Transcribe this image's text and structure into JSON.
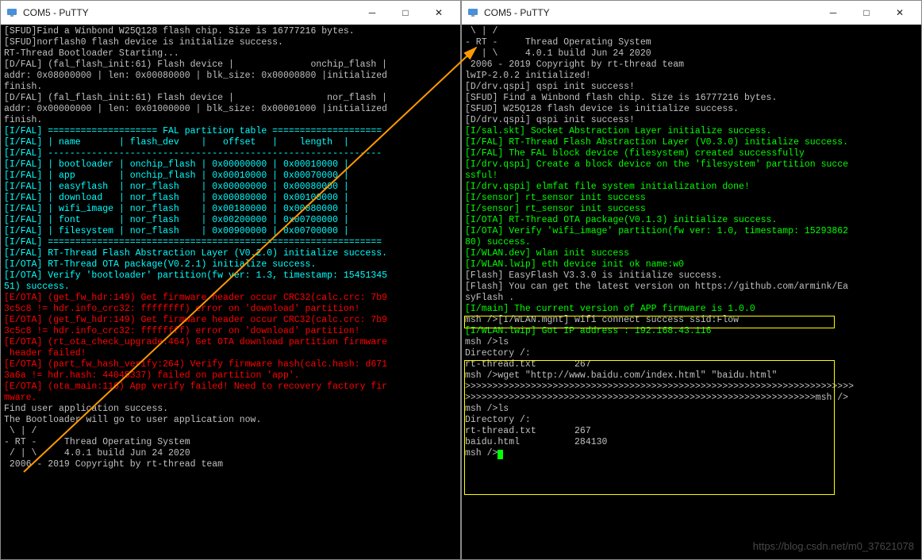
{
  "left": {
    "title": "COM5 - PuTTY",
    "lines": [
      {
        "c": "white",
        "t": "[SFUD]Find a Winbond W25Q128 flash chip. Size is 16777216 bytes."
      },
      {
        "c": "white",
        "t": "[SFUD]norflash0 flash device is initialize success."
      },
      {
        "c": "white",
        "t": ""
      },
      {
        "c": "white",
        "t": "RT-Thread Bootloader Starting..."
      },
      {
        "c": "white",
        "t": "[D/FAL] (fal_flash_init:61) Flash device |              onchip_flash |"
      },
      {
        "c": "white",
        "t": "addr: 0x08000000 | len: 0x00080000 | blk_size: 0x00000800 |initialized"
      },
      {
        "c": "white",
        "t": "finish."
      },
      {
        "c": "white",
        "t": "[D/FAL] (fal_flash_init:61) Flash device |                 nor_flash |"
      },
      {
        "c": "white",
        "t": "addr: 0x00000000 | len: 0x01000000 | blk_size: 0x00001000 |initialized"
      },
      {
        "c": "white",
        "t": "finish."
      },
      {
        "c": "cyan",
        "t": "[I/FAL] ==================== FAL partition table ===================="
      },
      {
        "c": "cyan",
        "t": "[I/FAL] | name       | flash_dev    |   offset   |    length  |"
      },
      {
        "c": "cyan",
        "t": "[I/FAL] -------------------------------------------------------------"
      },
      {
        "c": "cyan",
        "t": "[I/FAL] | bootloader | onchip_flash | 0x00000000 | 0x00010000 |"
      },
      {
        "c": "cyan",
        "t": "[I/FAL] | app        | onchip_flash | 0x00010000 | 0x00070000 |"
      },
      {
        "c": "cyan",
        "t": "[I/FAL] | easyflash  | nor_flash    | 0x00000000 | 0x00080000 |"
      },
      {
        "c": "cyan",
        "t": "[I/FAL] | download   | nor_flash    | 0x00080000 | 0x00100000 |"
      },
      {
        "c": "cyan",
        "t": "[I/FAL] | wifi_image | nor_flash    | 0x00180000 | 0x00080000 |"
      },
      {
        "c": "cyan",
        "t": "[I/FAL] | font       | nor_flash    | 0x00200000 | 0x00700000 |"
      },
      {
        "c": "cyan",
        "t": "[I/FAL] | filesystem | nor_flash    | 0x00900000 | 0x00700000 |"
      },
      {
        "c": "cyan",
        "t": "[I/FAL] ============================================================="
      },
      {
        "c": "cyan",
        "t": "[I/FAL] RT-Thread Flash Abstraction Layer (V0.2.0) initialize success."
      },
      {
        "c": "cyan",
        "t": "[I/OTA] RT-Thread OTA package(V0.2.1) initialize success."
      },
      {
        "c": "cyan",
        "t": "[I/OTA] Verify 'bootloader' partition(fw ver: 1.3, timestamp: 15451345"
      },
      {
        "c": "cyan",
        "t": "51) success."
      },
      {
        "c": "red",
        "t": "[E/OTA] (get_fw_hdr:149) Get firmware header occur CRC32(calc.crc: 7b9"
      },
      {
        "c": "red",
        "t": "3c5c8 != hdr.info_crc32: ffffffff) error on 'download' partition!"
      },
      {
        "c": "red",
        "t": "[E/OTA] (get_fw_hdr:149) Get firmware header occur CRC32(calc.crc: 7b9"
      },
      {
        "c": "red",
        "t": "3c5c8 != hdr.info_crc32: ffffffff) error on 'download' partition!"
      },
      {
        "c": "red",
        "t": "[E/OTA] (rt_ota_check_upgrade:464) Get OTA download partition firmware"
      },
      {
        "c": "red",
        "t": " header failed!"
      },
      {
        "c": "red",
        "t": "[E/OTA] (part_fw_hash_verify:264) Verify firmware hash(calc.hash: d671"
      },
      {
        "c": "red",
        "t": "3a6a != hdr.hash: 44045337) failed on partition 'app'."
      },
      {
        "c": "red",
        "t": "[E/OTA] (ota_main:116) App verify failed! Need to recovery factory fir"
      },
      {
        "c": "red",
        "t": "mware."
      },
      {
        "c": "white",
        "t": "Find user application success."
      },
      {
        "c": "white",
        "t": "The Bootloader will go to user application now."
      },
      {
        "c": "white",
        "t": ""
      },
      {
        "c": "white",
        "t": " \\ | /"
      },
      {
        "c": "white",
        "t": "- RT -     Thread Operating System"
      },
      {
        "c": "white",
        "t": " / | \\     4.0.1 build Jun 24 2020"
      },
      {
        "c": "white",
        "t": " 2006 - 2019 Copyright by rt-thread team"
      }
    ]
  },
  "right": {
    "title": "COM5 - PuTTY",
    "lines": [
      {
        "c": "white",
        "t": ""
      },
      {
        "c": "white",
        "t": " \\ | /"
      },
      {
        "c": "white",
        "t": "- RT -     Thread Operating System"
      },
      {
        "c": "white",
        "t": " / | \\     4.0.1 build Jun 24 2020"
      },
      {
        "c": "white",
        "t": " 2006 - 2019 Copyright by rt-thread team"
      },
      {
        "c": "white",
        "t": "lwIP-2.0.2 initialized!"
      },
      {
        "c": "white",
        "t": "[D/drv.qspi] qspi init success!"
      },
      {
        "c": "white",
        "t": "[SFUD] Find a Winbond flash chip. Size is 16777216 bytes."
      },
      {
        "c": "white",
        "t": "[SFUD] W25Q128 flash device is initialize success."
      },
      {
        "c": "white",
        "t": "[D/drv.qspi] qspi init success!"
      },
      {
        "c": "green",
        "t": "[I/sal.skt] Socket Abstraction Layer initialize success."
      },
      {
        "c": "green",
        "t": "[I/FAL] RT-Thread Flash Abstraction Layer (V0.3.0) initialize success."
      },
      {
        "c": "green",
        "t": "[I/FAL] The FAL block device (filesystem) created successfully"
      },
      {
        "c": "green",
        "t": "[I/drv.qspi] Create a block device on the 'filesystem' partition succe"
      },
      {
        "c": "green",
        "t": "ssful!"
      },
      {
        "c": "green",
        "t": "[I/drv.qspi] elmfat file system initialization done!"
      },
      {
        "c": "green",
        "t": "[I/sensor] rt_sensor init success"
      },
      {
        "c": "green",
        "t": "[I/sensor] rt_sensor init success"
      },
      {
        "c": "green",
        "t": "[I/OTA] RT-Thread OTA package(V0.1.3) initialize success."
      },
      {
        "c": "green",
        "t": "[I/OTA] Verify 'wifi_image' partition(fw ver: 1.0, timestamp: 15293862"
      },
      {
        "c": "green",
        "t": "80) success."
      },
      {
        "c": "green",
        "t": "[I/WLAN.dev] wlan init success"
      },
      {
        "c": "green",
        "t": "[I/WLAN.lwip] eth device init ok name:w0"
      },
      {
        "c": "white",
        "t": "[Flash] EasyFlash V3.3.0 is initialize success."
      },
      {
        "c": "white",
        "t": "[Flash] You can get the latest version on https://github.com/armink/Ea"
      },
      {
        "c": "white",
        "t": "syFlash ."
      },
      {
        "c": "green",
        "t": "[I/main] The current version of APP firmware is 1.0.0"
      },
      {
        "c": "white",
        "t": ""
      },
      {
        "c": "white",
        "t": "msh />[I/WLAN.mgnt] wifi connect success ssid:Flow"
      },
      {
        "c": "green",
        "t": "[I/WLAN.lwip] Got IP address : 192.168.43.116"
      },
      {
        "c": "white",
        "t": ""
      },
      {
        "c": "white",
        "t": "msh />ls"
      },
      {
        "c": "white",
        "t": "Directory /:"
      },
      {
        "c": "white",
        "t": "rt-thread.txt       267"
      },
      {
        "c": "white",
        "t": "msh />wget \"http://www.baidu.com/index.html\" \"baidu.html\""
      },
      {
        "c": "white",
        "t": ">>>>>>>>>>>>>>>>>>>>>>>>>>>>>>>>>>>>>>>>>>>>>>>>>>>>>>>>>>>>>>>>>>>>>>>"
      },
      {
        "c": "white",
        "t": ">>>>>>>>>>>>>>>>>>>>>>>>>>>>>>>>>>>>>>>>>>>>>>>>>>>>>>>>>>>>>>>>msh />"
      },
      {
        "c": "white",
        "t": "msh />ls"
      },
      {
        "c": "white",
        "t": "Directory /:"
      },
      {
        "c": "white",
        "t": "rt-thread.txt       267"
      },
      {
        "c": "white",
        "t": "baidu.html          284130"
      },
      {
        "c": "white",
        "t": "msh />"
      }
    ]
  },
  "watermark": "https://blog.csdn.net/m0_37621078"
}
